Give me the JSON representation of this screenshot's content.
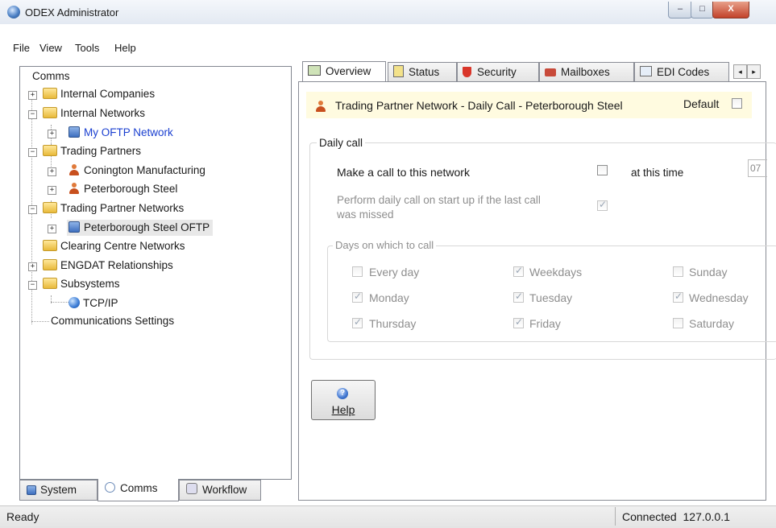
{
  "window": {
    "title": "ODEX Administrator",
    "min": "–",
    "max": "□",
    "close": "X"
  },
  "menu": {
    "file": "File",
    "view": "View",
    "tools": "Tools",
    "help": "Help"
  },
  "tree": {
    "root": "Comms",
    "internal_companies": "Internal Companies",
    "internal_networks": "Internal Networks",
    "my_oftp_network": "My OFTP Network",
    "trading_partners": "Trading Partners",
    "conington": "Conington Manufacturing",
    "peterborough": "Peterborough Steel",
    "trading_partner_networks": "Trading Partner Networks",
    "peterborough_oftp": "Peterborough Steel OFTP",
    "clearing_centre": "Clearing Centre Networks",
    "engdat": "ENGDAT Relationships",
    "subsystems": "Subsystems",
    "tcpip": "TCP/IP",
    "comm_settings": "Communications Settings"
  },
  "bottom_tabs": {
    "system": "System",
    "comms": "Comms",
    "workflow": "Workflow"
  },
  "right_tabs": {
    "overview": "Overview",
    "status": "Status",
    "security": "Security",
    "mailboxes": "Mailboxes",
    "edi_codes": "EDI Codes",
    "prev": "◂",
    "next": "▸"
  },
  "panel": {
    "header_title": "Trading Partner Network - Daily Call - Peterborough Steel",
    "default_label": "Default",
    "daily_call_group": "Daily call",
    "make_call_label": "Make a call to this network",
    "at_time_label": "at this time",
    "time_value": "07",
    "perform_line1": "Perform daily call on start up if the last call",
    "perform_line2": "was missed",
    "days_group": "Days on which to call",
    "days": {
      "every_day": "Every day",
      "weekdays": "Weekdays",
      "sunday": "Sunday",
      "monday": "Monday",
      "tuesday": "Tuesday",
      "wednesday": "Wednesday",
      "thursday": "Thursday",
      "friday": "Friday",
      "saturday": "Saturday"
    },
    "help_label": "Help"
  },
  "status": {
    "left": "Ready",
    "right": "Connected  127.0.0.1"
  }
}
